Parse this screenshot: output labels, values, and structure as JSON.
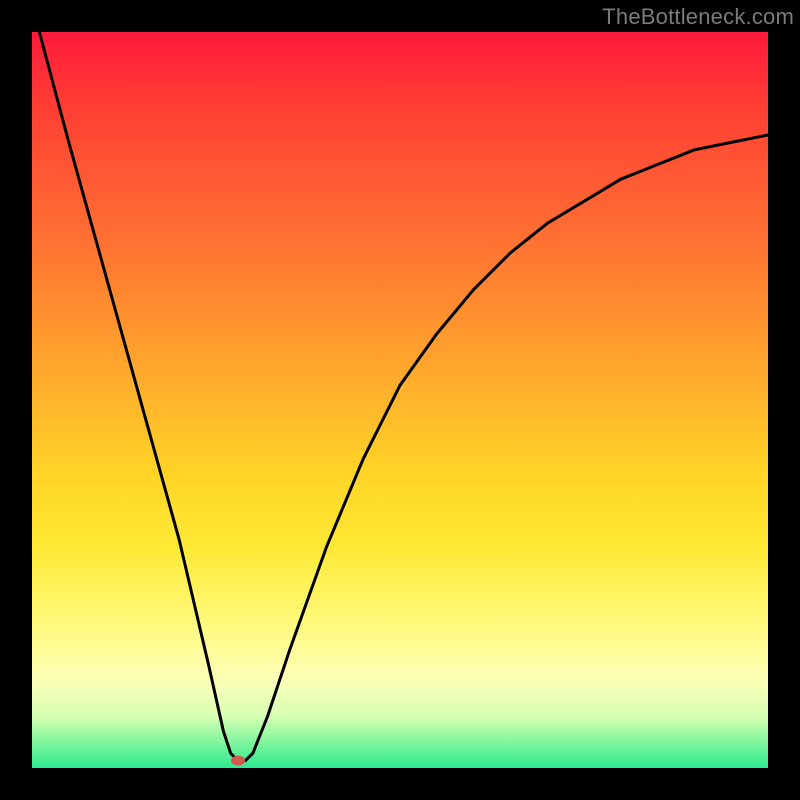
{
  "watermark": {
    "text": "TheBottleneck.com"
  },
  "chart_data": {
    "type": "line",
    "title": "",
    "xlabel": "",
    "ylabel": "",
    "xlim": [
      0,
      100
    ],
    "ylim": [
      0,
      100
    ],
    "grid": false,
    "series": [
      {
        "name": "curve",
        "x": [
          1,
          5,
          10,
          15,
          20,
          24,
          26,
          27,
          28,
          29,
          30,
          32,
          35,
          40,
          45,
          50,
          55,
          60,
          65,
          70,
          75,
          80,
          85,
          90,
          95,
          100
        ],
        "y": [
          100,
          85,
          67,
          49,
          31,
          14,
          5,
          2,
          1,
          1,
          2,
          7,
          16,
          30,
          42,
          52,
          59,
          65,
          70,
          74,
          77,
          80,
          82,
          84,
          85,
          86
        ]
      }
    ],
    "markers": [
      {
        "name": "min-marker",
        "x": 28,
        "y": 1,
        "color": "#d05b4e"
      }
    ],
    "background_gradient": {
      "stops": [
        {
          "pos": 0,
          "color": "#ff1a3a"
        },
        {
          "pos": 50,
          "color": "#ffb52b"
        },
        {
          "pos": 80,
          "color": "#fff97a"
        },
        {
          "pos": 100,
          "color": "#2dea8f"
        }
      ]
    }
  }
}
